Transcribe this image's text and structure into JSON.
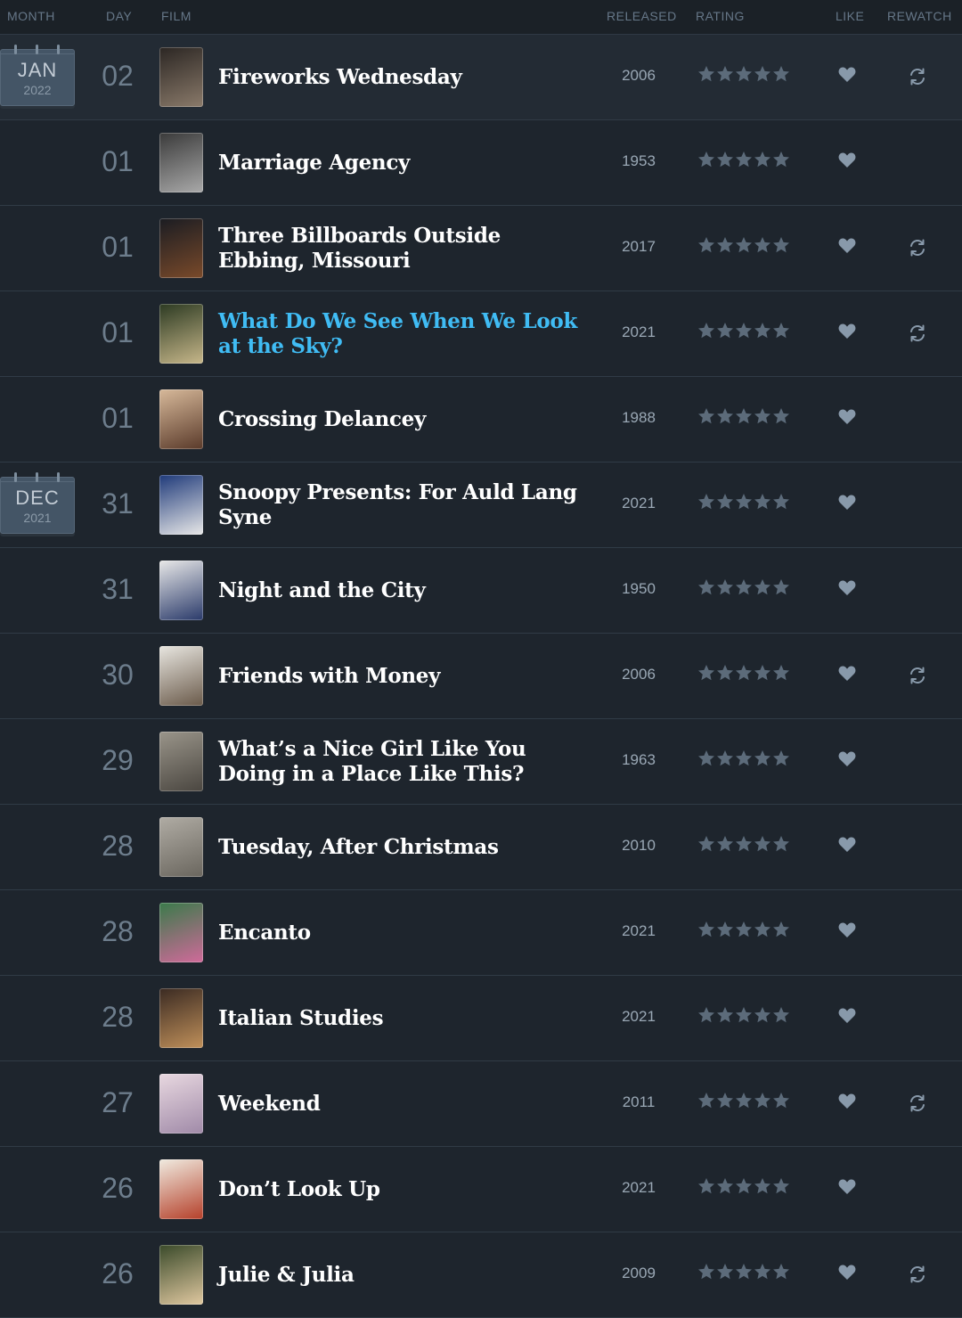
{
  "header": {
    "month": "Month",
    "day": "Day",
    "film": "Film",
    "released": "Released",
    "rating": "Rating",
    "like": "Like",
    "rewatch": "Rewatch"
  },
  "colors": {
    "background": "#1f262e",
    "link": "#40bcf4",
    "star": "#5c6b7a",
    "icon": "#8899aa"
  },
  "rating_stars_each_row": 5,
  "entries": [
    {
      "month": "JAN",
      "year": "2022",
      "day": "02",
      "title": "Fireworks Wednesday",
      "released": "2006",
      "liked": true,
      "rewatch": true,
      "highlight": true,
      "link": false,
      "poster": [
        "#2b2623",
        "#8a7a6a"
      ]
    },
    {
      "day": "01",
      "title": "Marriage Agency",
      "released": "1953",
      "liked": true,
      "rewatch": false,
      "link": false,
      "poster": [
        "#3a3a3a",
        "#a9a9a9"
      ]
    },
    {
      "day": "01",
      "title": "Three Billboards Outside Ebbing, Missouri",
      "released": "2017",
      "liked": true,
      "rewatch": true,
      "link": false,
      "poster": [
        "#1a1c22",
        "#7a4a2a"
      ]
    },
    {
      "day": "01",
      "title": "What Do We See When We Look at the Sky?",
      "released": "2021",
      "liked": true,
      "rewatch": true,
      "link": true,
      "poster": [
        "#2c3a22",
        "#c7b78a"
      ]
    },
    {
      "day": "01",
      "title": "Crossing Delancey",
      "released": "1988",
      "liked": true,
      "rewatch": false,
      "link": false,
      "poster": [
        "#d7b99a",
        "#5a3a2a"
      ]
    },
    {
      "month": "DEC",
      "year": "2021",
      "day": "31",
      "title": "Snoopy Presents: For Auld Lang Syne",
      "released": "2021",
      "liked": true,
      "rewatch": false,
      "link": false,
      "poster": [
        "#1f3a7a",
        "#e8e8e8"
      ]
    },
    {
      "day": "31",
      "title": "Night and the City",
      "released": "1950",
      "liked": true,
      "rewatch": false,
      "link": false,
      "poster": [
        "#e8e8e8",
        "#2a3a6a"
      ]
    },
    {
      "day": "30",
      "title": "Friends with Money",
      "released": "2006",
      "liked": true,
      "rewatch": true,
      "link": false,
      "poster": [
        "#e8e6e0",
        "#6a5a4a"
      ]
    },
    {
      "day": "29",
      "title": "What’s a Nice Girl Like You Doing in a Place Like This?",
      "released": "1963",
      "liked": true,
      "rewatch": false,
      "link": false,
      "poster": [
        "#9a958a",
        "#4a4640"
      ]
    },
    {
      "day": "28",
      "title": "Tuesday, After Christmas",
      "released": "2010",
      "liked": true,
      "rewatch": false,
      "link": false,
      "poster": [
        "#b0aca4",
        "#6a665e"
      ]
    },
    {
      "day": "28",
      "title": "Encanto",
      "released": "2021",
      "liked": true,
      "rewatch": false,
      "link": false,
      "poster": [
        "#3a7a4a",
        "#d06a9a"
      ]
    },
    {
      "day": "28",
      "title": "Italian Studies",
      "released": "2021",
      "liked": true,
      "rewatch": false,
      "link": false,
      "poster": [
        "#3a2a22",
        "#c0905a"
      ]
    },
    {
      "day": "27",
      "title": "Weekend",
      "released": "2011",
      "liked": true,
      "rewatch": true,
      "link": false,
      "poster": [
        "#e8d8e0",
        "#a08aa8"
      ]
    },
    {
      "day": "26",
      "title": "Don’t Look Up",
      "released": "2021",
      "liked": true,
      "rewatch": false,
      "link": false,
      "poster": [
        "#f0ebe0",
        "#b5402a"
      ]
    },
    {
      "day": "26",
      "title": "Julie & Julia",
      "released": "2009",
      "liked": true,
      "rewatch": true,
      "link": false,
      "poster": [
        "#3a4a2a",
        "#e0c8a0"
      ]
    }
  ]
}
